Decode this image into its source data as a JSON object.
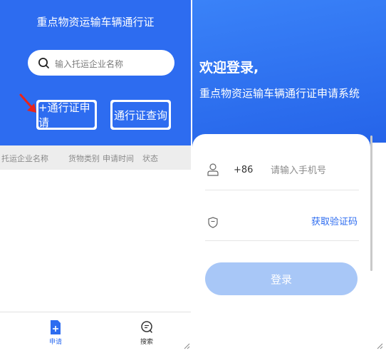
{
  "left_app": {
    "title": "重点物资运输车辆通行证",
    "search": {
      "placeholder": "输入托运企业名称"
    },
    "buttons": {
      "apply": "+通行证申请",
      "query": "通行证查询"
    },
    "table": {
      "columns": [
        "托运企业名称",
        "货物类别",
        "申请时间",
        "状态"
      ]
    },
    "tabs": [
      {
        "label": "申请",
        "icon": "add-document-icon",
        "active": true
      },
      {
        "label": "搜索",
        "icon": "search-icon",
        "active": false
      }
    ]
  },
  "right_app": {
    "welcome": "欢迎登录,",
    "system_name": "重点物资运输车辆通行证申请系统",
    "phone": {
      "prefix": "+86",
      "placeholder": "请输入手机号"
    },
    "code": {
      "get_code_label": "获取验证码"
    },
    "login_label": "登录"
  },
  "colors": {
    "primary_blue": "#2d6cf0",
    "login_button": "#a8c7f7",
    "arrow_red": "#e8241b",
    "table_header_bg": "#ededed"
  }
}
